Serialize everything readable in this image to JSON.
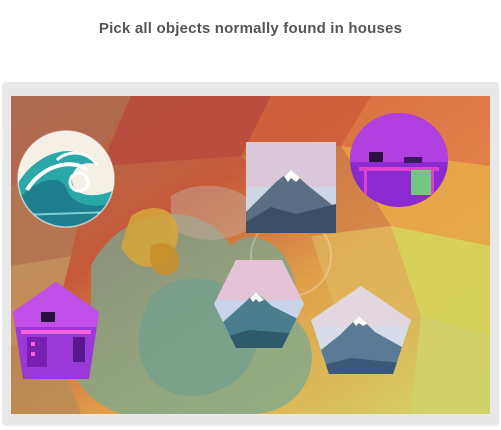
{
  "page": {
    "instruction": "Pick all objects normally found in houses"
  },
  "captcha": {
    "tiles": [
      {
        "subject": "ocean-wave",
        "shape": "circle"
      },
      {
        "subject": "mountain",
        "shape": "square"
      },
      {
        "subject": "neon-desk",
        "shape": "circle"
      },
      {
        "subject": "neon-desk",
        "shape": "pentagon"
      },
      {
        "subject": "mountain",
        "shape": "hexagon"
      },
      {
        "subject": "mountain",
        "shape": "pentagon"
      }
    ]
  },
  "colors": {
    "instruction_text": "#555555",
    "frame_background": "#e8e8e8",
    "neon_purple": "#b040e0",
    "neon_pink": "#e040d0",
    "wave_teal": "#2aa7a7"
  }
}
